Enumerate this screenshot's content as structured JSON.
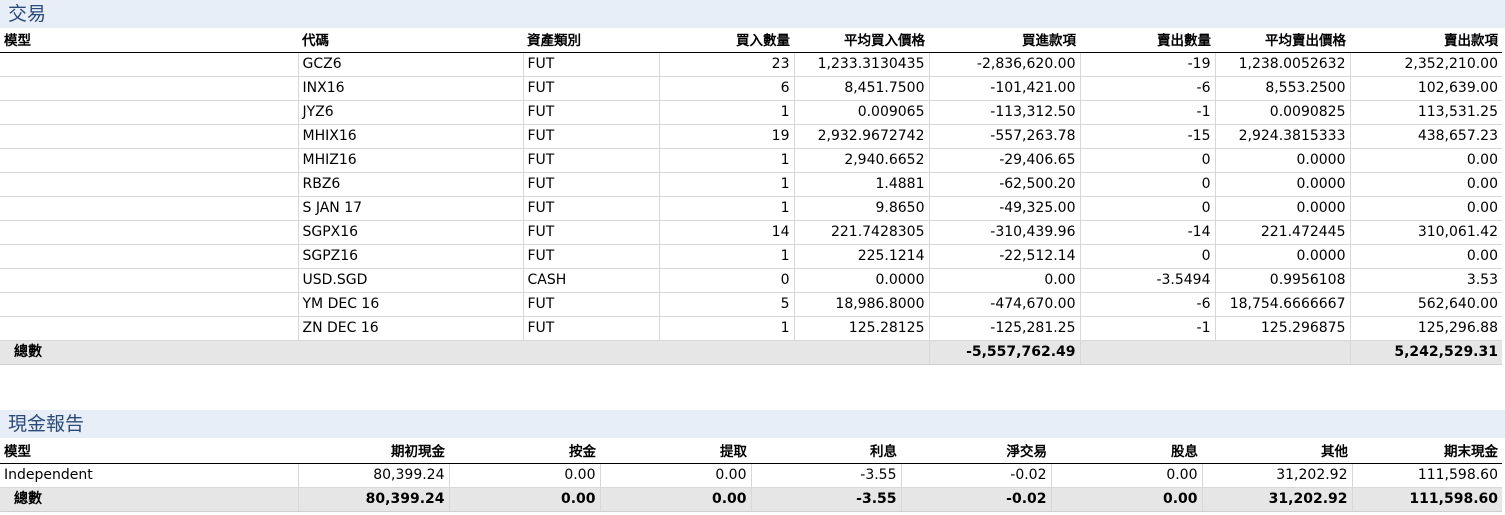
{
  "trades": {
    "title": "交易",
    "headers": [
      "模型",
      "代碼",
      "資產類別",
      "買入數量",
      "平均買入價格",
      "買進款項",
      "賣出數量",
      "平均賣出價格",
      "賣出款項"
    ],
    "rows": [
      [
        "",
        "GCZ6",
        "FUT",
        "23",
        "1,233.3130435",
        "-2,836,620.00",
        "-19",
        "1,238.0052632",
        "2,352,210.00"
      ],
      [
        "",
        "INX16",
        "FUT",
        "6",
        "8,451.7500",
        "-101,421.00",
        "-6",
        "8,553.2500",
        "102,639.00"
      ],
      [
        "",
        "JYZ6",
        "FUT",
        "1",
        "0.009065",
        "-113,312.50",
        "-1",
        "0.0090825",
        "113,531.25"
      ],
      [
        "",
        "MHIX16",
        "FUT",
        "19",
        "2,932.9672742",
        "-557,263.78",
        "-15",
        "2,924.3815333",
        "438,657.23"
      ],
      [
        "",
        "MHIZ16",
        "FUT",
        "1",
        "2,940.6652",
        "-29,406.65",
        "0",
        "0.0000",
        "0.00"
      ],
      [
        "",
        "RBZ6",
        "FUT",
        "1",
        "1.4881",
        "-62,500.20",
        "0",
        "0.0000",
        "0.00"
      ],
      [
        "",
        "S   JAN 17",
        "FUT",
        "1",
        "9.8650",
        "-49,325.00",
        "0",
        "0.0000",
        "0.00"
      ],
      [
        "",
        "SGPX16",
        "FUT",
        "14",
        "221.7428305",
        "-310,439.96",
        "-14",
        "221.472445",
        "310,061.42"
      ],
      [
        "",
        "SGPZ16",
        "FUT",
        "1",
        "225.1214",
        "-22,512.14",
        "0",
        "0.0000",
        "0.00"
      ],
      [
        "",
        "USD.SGD",
        "CASH",
        "0",
        "0.0000",
        "0.00",
        "-3.5494",
        "0.9956108",
        "3.53"
      ],
      [
        "",
        "YM   DEC 16",
        "FUT",
        "5",
        "18,986.8000",
        "-474,670.00",
        "-6",
        "18,754.6666667",
        "562,640.00"
      ],
      [
        "",
        "ZN   DEC 16",
        "FUT",
        "1",
        "125.28125",
        "-125,281.25",
        "-1",
        "125.296875",
        "125,296.88"
      ]
    ],
    "total": {
      "label": "總數",
      "buy_proceeds": "-5,557,762.49",
      "sell_proceeds": "5,242,529.31"
    }
  },
  "cash": {
    "title": "現金報告",
    "headers": [
      "模型",
      "期初現金",
      "按金",
      "提取",
      "利息",
      "淨交易",
      "股息",
      "其他",
      "期末現金"
    ],
    "rows": [
      [
        "Independent",
        "80,399.24",
        "0.00",
        "0.00",
        "-3.55",
        "-0.02",
        "0.00",
        "31,202.92",
        "111,598.60"
      ]
    ],
    "total": [
      "總數",
      "80,399.24",
      "0.00",
      "0.00",
      "-3.55",
      "-0.02",
      "0.00",
      "31,202.92",
      "111,598.60"
    ]
  }
}
